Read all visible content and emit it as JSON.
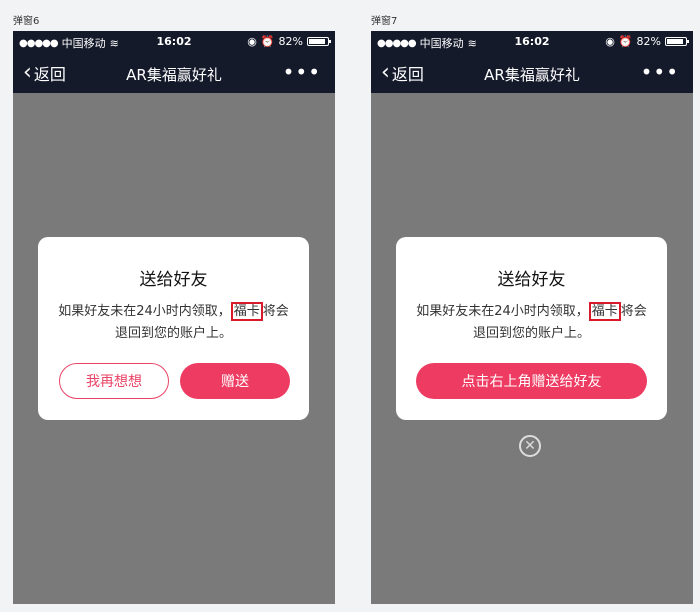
{
  "screens": [
    {
      "caption": "弹窗6",
      "status": {
        "carrier": "中国移动",
        "time": "16:02",
        "battery": "82%"
      },
      "nav": {
        "back": "返回",
        "title": "AR集福赢好礼",
        "more": "•••"
      },
      "dialog": {
        "title": "送给好友",
        "line1_prefix": "如果好友未在24小时内领取，",
        "highlight": "福卡",
        "line1_suffix": "将会",
        "line2": "退回到您的账户上。",
        "buttons": {
          "cancel": "我再想想",
          "confirm": "赠送"
        }
      }
    },
    {
      "caption": "弹窗7",
      "status": {
        "carrier": "中国移动",
        "time": "16:02",
        "battery": "82%"
      },
      "nav": {
        "back": "返回",
        "title": "AR集福赢好礼",
        "more": "•••"
      },
      "dialog": {
        "title": "送给好友",
        "line1_prefix": "如果好友未在24小时内领取，",
        "highlight": "福卡",
        "line1_suffix": "将会",
        "line2": "退回到您的账户上。",
        "buttons": {
          "primary": "点击右上角赠送给好友"
        }
      },
      "close_icon": "close-circle-icon"
    }
  ],
  "colors": {
    "accent": "#ee3b62",
    "highlight_box": "#d81a2a",
    "nav_bg": "#151a2b",
    "overlay": "#7a7a7a"
  }
}
